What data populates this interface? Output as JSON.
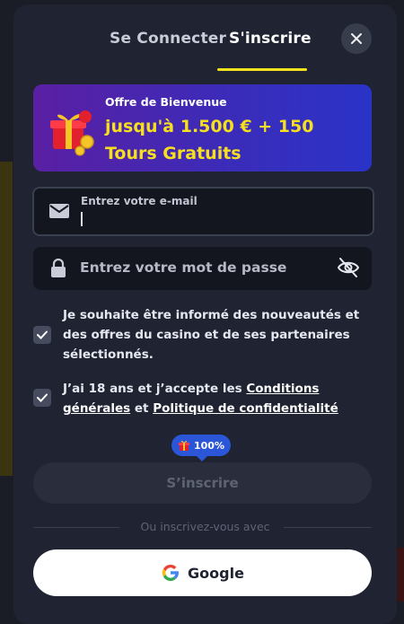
{
  "tabs": {
    "login": "Se Connecter",
    "signup": "S'inscrire",
    "active": "signup"
  },
  "promo": {
    "subtitle": "Offre de Bienvenue",
    "title": "jusqu'à 1.500 € + 150 Tours Gratuits"
  },
  "email": {
    "label": "Entrez votre e-mail",
    "value": ""
  },
  "password": {
    "placeholder": "Entrez votre mot de passe",
    "value": ""
  },
  "consents": {
    "newsletter": {
      "checked": true,
      "text": "Je souhaite être informé des nouveautés et des offres du casino et de ses partenaires sélectionnés."
    },
    "terms": {
      "checked": true,
      "prefix": "J’ai 18 ans et j’accepte les",
      "terms_link": "Conditions générales",
      "conjunction": "et",
      "privacy_link": "Politique de confidentialité"
    }
  },
  "progress": {
    "label": "100%",
    "value": 100
  },
  "submit_label": "S’inscrire",
  "divider_text": "Ou inscrivez-vous avec",
  "google_label": "Google",
  "colors": {
    "accent": "#f3e21c",
    "modal_bg": "#1f2332",
    "badge": "#2b56d8"
  },
  "icons": [
    "close-icon",
    "gift-icon",
    "mail-icon",
    "lock-icon",
    "eye-off-icon",
    "check-icon",
    "google-icon"
  ]
}
